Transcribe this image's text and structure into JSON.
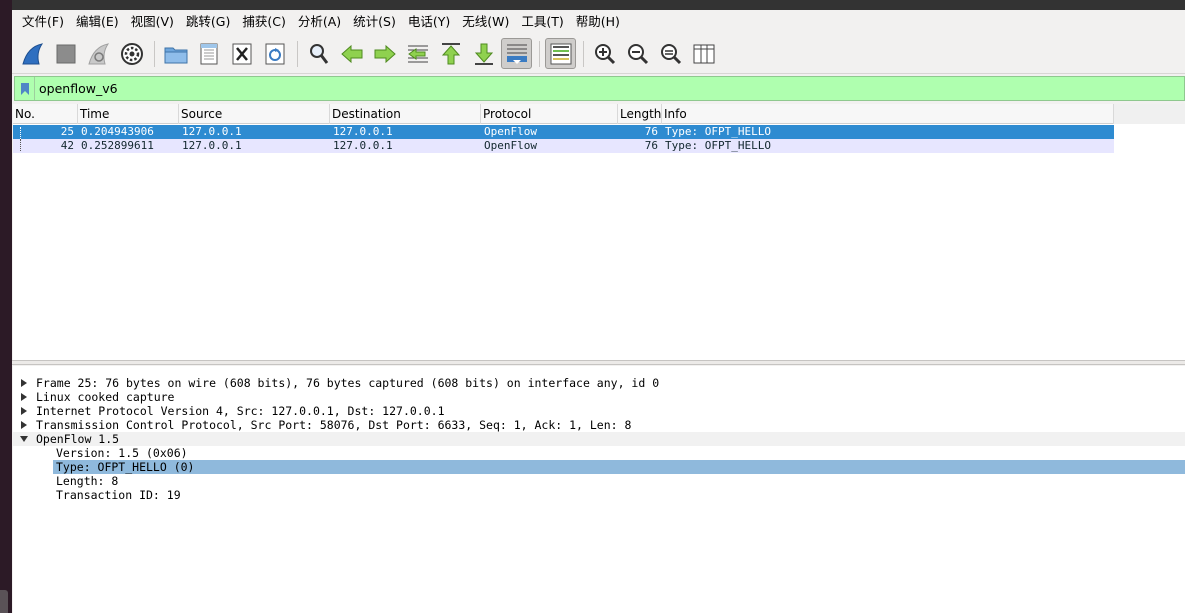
{
  "menubar": {
    "items": [
      "文件(F)",
      "编辑(E)",
      "视图(V)",
      "跳转(G)",
      "捕获(C)",
      "分析(A)",
      "统计(S)",
      "电话(Y)",
      "无线(W)",
      "工具(T)",
      "帮助(H)"
    ]
  },
  "filter": {
    "value": "openflow_v6"
  },
  "packet_list": {
    "columns": [
      "No.",
      "Time",
      "Source",
      "Destination",
      "Protocol",
      "Length",
      "Info"
    ],
    "rows": [
      {
        "no": "25",
        "time": "0.204943906",
        "source": "127.0.0.1",
        "destination": "127.0.0.1",
        "protocol": "OpenFlow",
        "length": "76",
        "info": "Type: OFPT_HELLO"
      },
      {
        "no": "42",
        "time": "0.252899611",
        "source": "127.0.0.1",
        "destination": "127.0.0.1",
        "protocol": "OpenFlow",
        "length": "76",
        "info": "Type: OFPT_HELLO"
      }
    ]
  },
  "details": {
    "lines": [
      "Frame 25: 76 bytes on wire (608 bits), 76 bytes captured (608 bits) on interface any, id 0",
      "Linux cooked capture",
      "Internet Protocol Version 4, Src: 127.0.0.1, Dst: 127.0.0.1",
      "Transmission Control Protocol, Src Port: 58076, Dst Port: 6633, Seq: 1, Ack: 1, Len: 8",
      "OpenFlow 1.5",
      "Version: 1.5 (0x06)",
      "Type: OFPT_HELLO (0)",
      "Length: 8",
      "Transaction ID: 19"
    ]
  },
  "colors": {
    "filter_ok_bg": "#afffaf",
    "selected_row": "#2e8bd1",
    "openflow_row": "#e7e6ff",
    "selected_detail": "#8fb9dc"
  },
  "toolbar_icons": [
    "shark-fin-start-icon",
    "stop-square-icon",
    "restart-fin-icon",
    "capture-options-gear-icon",
    "open-folder-icon",
    "save-file-icon",
    "close-file-icon",
    "reload-file-icon",
    "find-magnifier-icon",
    "go-back-arrow-icon",
    "go-forward-arrow-icon",
    "go-to-packet-icon",
    "first-packet-icon",
    "last-packet-icon",
    "autoscroll-icon",
    "colorize-icon",
    "zoom-in-icon",
    "zoom-out-icon",
    "zoom-normal-icon",
    "resize-columns-icon"
  ]
}
